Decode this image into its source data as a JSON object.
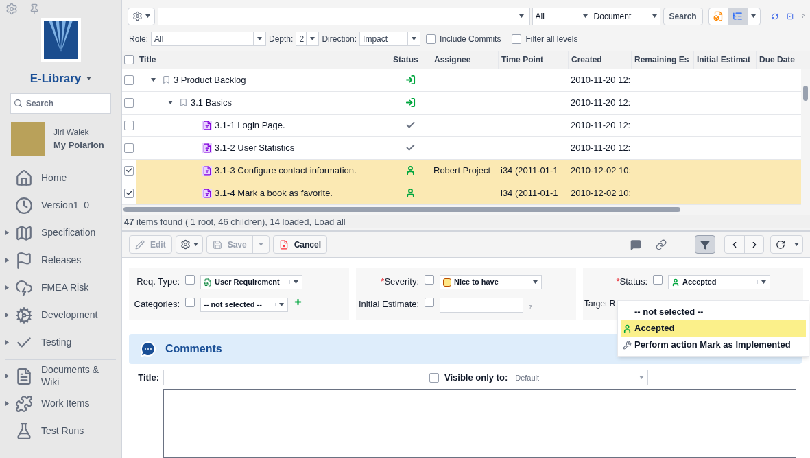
{
  "sidebar": {
    "project": "E-Library",
    "search_placeholder": "Search",
    "user": {
      "name": "Jiri Walek",
      "link": "My Polarion"
    },
    "nav": [
      {
        "label": "Home",
        "expandable": false
      },
      {
        "label": "Version1_0",
        "expandable": false
      },
      {
        "label": "Specification",
        "expandable": true
      },
      {
        "label": "Releases",
        "expandable": true
      },
      {
        "label": "FMEA Risk",
        "expandable": true
      },
      {
        "label": "Development",
        "expandable": true
      },
      {
        "label": "Testing",
        "expandable": true
      },
      {
        "label": "Documents & Wiki",
        "expandable": true,
        "divider_before": true
      },
      {
        "label": "Work Items",
        "expandable": true
      },
      {
        "label": "Test Runs",
        "expandable": false
      }
    ]
  },
  "search_bar": {
    "scope": "All",
    "type": "Document",
    "button": "Search",
    "help": "?"
  },
  "filters": {
    "role_label": "Role:",
    "role": "All",
    "depth_label": "Depth:",
    "depth": "2",
    "direction_label": "Direction:",
    "direction": "Impact",
    "options": [
      {
        "label": "Include Commits",
        "checked": false
      },
      {
        "label": "Filter all levels",
        "checked": false
      }
    ]
  },
  "table": {
    "select_all": false,
    "columns": [
      "Title",
      "Status",
      "Assignee",
      "Time Point",
      "Created",
      "Remaining Es",
      "Initial Estimat",
      "Due Date"
    ],
    "rows": [
      {
        "title": "3 Product Backlog",
        "kind": "in-progress",
        "created": "2010-11-20 12:",
        "checked": false,
        "selected": false,
        "expanded": true,
        "children": [
          {
            "title": "3.1 Basics",
            "kind": "in-progress",
            "created": "2010-11-20 12:",
            "checked": false,
            "selected": false,
            "expanded": true,
            "children": [
              {
                "title": "3.1-1 Login Page.",
                "kind": "done",
                "created": "2010-11-20 12:",
                "checked": false,
                "selected": false
              },
              {
                "title": "3.1-2 User Statistics",
                "kind": "done",
                "created": "2010-11-20 12:",
                "checked": false,
                "selected": false
              },
              {
                "title": "3.1-3 Configure contact information.",
                "kind": "accepted",
                "assignee": "Robert Project",
                "time_point": "i34 (2011-01-1",
                "created": "2010-12-02 10:",
                "checked": true,
                "selected": true
              },
              {
                "title": "3.1-4 Mark a book as favorite.",
                "kind": "accepted",
                "time_point": "i34 (2011-01-1",
                "created": "2010-12-02 10:",
                "checked": true,
                "selected": true
              }
            ]
          }
        ]
      }
    ],
    "summary": "**47** items found ( 1 root, 46 children), 14 loaded,",
    "load_all": "Load all"
  },
  "editor_toolbar": {
    "buttons": [
      {
        "label": "Edit",
        "disabled": true
      },
      {
        "label": "Save",
        "disabled": true
      },
      {
        "label": "Cancel",
        "disabled": false
      }
    ]
  },
  "form": {
    "req_type_label": "Req. Type:",
    "req_type_checked": false,
    "req_type": "User Requirement",
    "categories_label": "Categories:",
    "categories_checked": false,
    "categories": "-- not selected --",
    "severity_mark": "*",
    "severity_label": "Severity:",
    "severity_checked": false,
    "severity": "Nice to have",
    "initial_estimate_label": "Initial Estimate:",
    "initial_estimate_checked": false,
    "hint": "?",
    "status_mark": "*",
    "status_label": "Status:",
    "status_checked": false,
    "status": "Accepted",
    "target_label": "Target R"
  },
  "status_menu": [
    {
      "label": "-- not selected --",
      "selected": false,
      "kind": "none"
    },
    {
      "label": "Accepted",
      "selected": true,
      "kind": "accepted"
    },
    {
      "label": "Perform action Mark as Implemented",
      "selected": false,
      "kind": "action"
    }
  ],
  "comments": {
    "title": "Comments",
    "title_label": "Title:",
    "visible_label": "Visible only to:",
    "visible_checked": false,
    "visible_placeholder": "Default"
  }
}
